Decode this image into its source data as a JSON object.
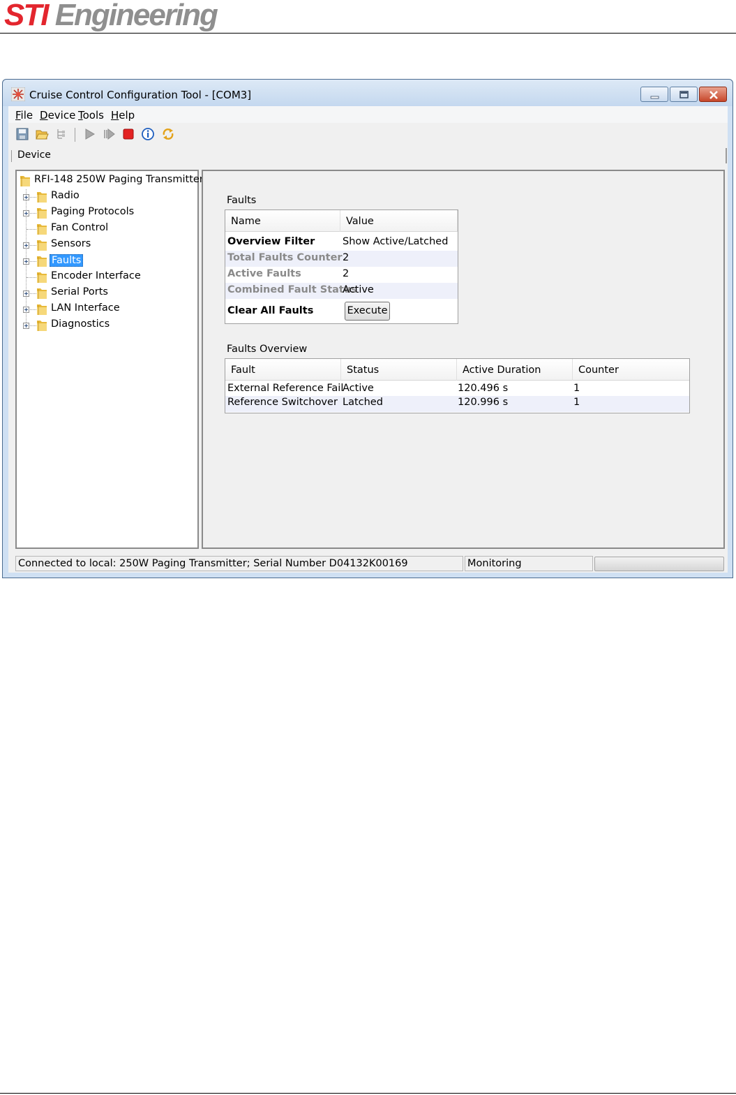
{
  "document": {
    "logo_sti": "STI",
    "logo_engineering": "Engineering"
  },
  "window": {
    "title": "Cruise Control Configuration Tool - [COM3]",
    "app_icon": "star-burst-icon"
  },
  "menu": {
    "items": [
      {
        "mnemonic": "F",
        "rest": "ile"
      },
      {
        "mnemonic": "D",
        "rest": "evice"
      },
      {
        "mnemonic": "T",
        "rest": "ools"
      },
      {
        "mnemonic": "H",
        "rest": "elp"
      }
    ]
  },
  "toolbar": {
    "icons": [
      "save-icon",
      "open-folder-icon",
      "tree-icon",
      "play-icon",
      "step-icon",
      "stop-icon",
      "info-icon",
      "refresh-icon"
    ]
  },
  "devicebar": {
    "label": "Device"
  },
  "tree": {
    "root": "RFI-148 250W Paging Transmitter",
    "items": [
      {
        "label": "Radio",
        "expandable": true
      },
      {
        "label": "Paging Protocols",
        "expandable": true
      },
      {
        "label": "Fan Control",
        "expandable": false
      },
      {
        "label": "Sensors",
        "expandable": true
      },
      {
        "label": "Faults",
        "expandable": true,
        "selected": true
      },
      {
        "label": "Encoder Interface",
        "expandable": false
      },
      {
        "label": "Serial Ports",
        "expandable": true
      },
      {
        "label": "LAN Interface",
        "expandable": true
      },
      {
        "label": "Diagnostics",
        "expandable": true
      }
    ]
  },
  "faults": {
    "section_title": "Faults",
    "columns": [
      "Name",
      "Value"
    ],
    "rows": [
      {
        "name": "Overview Filter",
        "value": "Show Active/Latched"
      },
      {
        "name": "Total Faults Counter",
        "value": "2"
      },
      {
        "name": "Active Faults",
        "value": "2"
      },
      {
        "name": "Combined Fault Status",
        "value": "Active"
      },
      {
        "name": "Clear All Faults",
        "button": "Execute"
      }
    ]
  },
  "overview": {
    "section_title": "Faults Overview",
    "columns": [
      "Fault",
      "Status",
      "Active Duration",
      "Counter"
    ],
    "rows": [
      [
        "External Reference Fail",
        "Active",
        "120.496 s",
        "1"
      ],
      [
        "Reference Switchover",
        "Latched",
        "120.996 s",
        "1"
      ]
    ]
  },
  "statusbar": {
    "connection": "Connected to local: 250W Paging Transmitter; Serial Number D04132K00169",
    "mode": "Monitoring"
  }
}
